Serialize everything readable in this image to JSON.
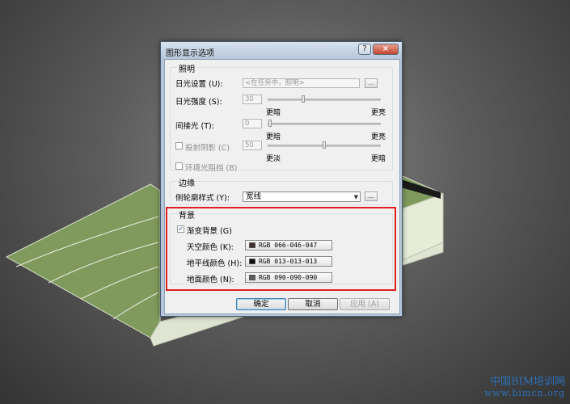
{
  "dialog": {
    "title": "图形显示选项",
    "help_glyph": "?",
    "close_glyph": "×"
  },
  "lighting": {
    "group_title": "照明",
    "sunlight_label": "日光设置 (U):",
    "sunlight_value": "<在任务中，照明>",
    "browse_glyph": "...",
    "brightness_label": "日光强度 (S):",
    "brightness_value": "30",
    "brightness_min": "更暗",
    "brightness_max": "更亮",
    "indirect_label": "间接光 (T):",
    "indirect_value": "0",
    "indirect_min": "更暗",
    "indirect_max": "更亮",
    "shadow_label": "投射阴影 (C)",
    "shadow_value": "50",
    "shadow_min": "更淡",
    "shadow_max": "更暗",
    "ambient_label": "环境光阻挡 (B)"
  },
  "edges": {
    "group_title": "边缘",
    "silhouette_label": "侧轮廓样式 (Y):",
    "silhouette_value": "宽线",
    "browse_glyph": "..."
  },
  "background": {
    "group_title": "背景",
    "gradient_label": "渐变背景 (G)",
    "gradient_checked_glyph": "✓",
    "sky_label": "天空颜色 (K):",
    "sky_value": "RGB 066-046-047",
    "sky_color": "#422e2f",
    "horizon_label": "地平线颜色 (H):",
    "horizon_value": "RGB 013-013-013",
    "horizon_color": "#0d0d0d",
    "ground_label": "地面颜色 (N):",
    "ground_value": "RGB 090-090-090",
    "ground_color": "#5a5a5a"
  },
  "buttons": {
    "ok": "确定",
    "cancel": "取消",
    "apply": "应用 (A)"
  },
  "watermark": {
    "line1": "中国BIM培训网",
    "line2": "www.bimcn.org"
  }
}
